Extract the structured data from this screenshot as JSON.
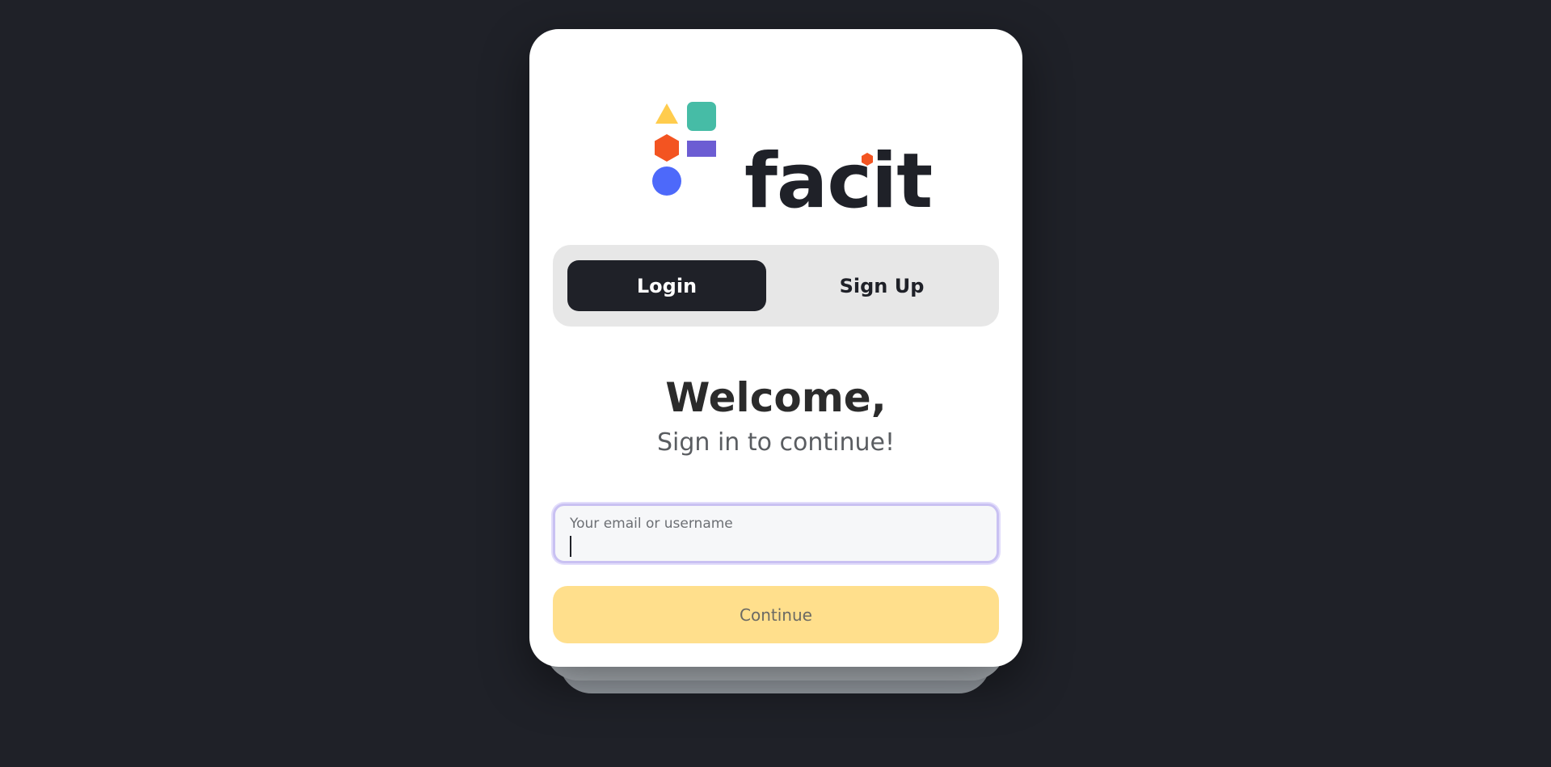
{
  "brand": {
    "name": "facit",
    "colors": {
      "yellow": "#ffcc4d",
      "teal": "#46bca6",
      "orange": "#f35421",
      "purple": "#6c5dd3",
      "blue": "#4d69fa"
    }
  },
  "tabs": [
    {
      "label": "Login",
      "active": true
    },
    {
      "label": "Sign Up",
      "active": false
    }
  ],
  "heading": {
    "title": "Welcome,",
    "subtitle": "Sign in to continue!"
  },
  "form": {
    "email_label": "Your email or username",
    "email_value": ""
  },
  "actions": {
    "continue_label": "Continue"
  },
  "theme": {
    "background": "#1f2128",
    "accent_button": "#ffdf8c",
    "active_tab": "#1f2128"
  }
}
